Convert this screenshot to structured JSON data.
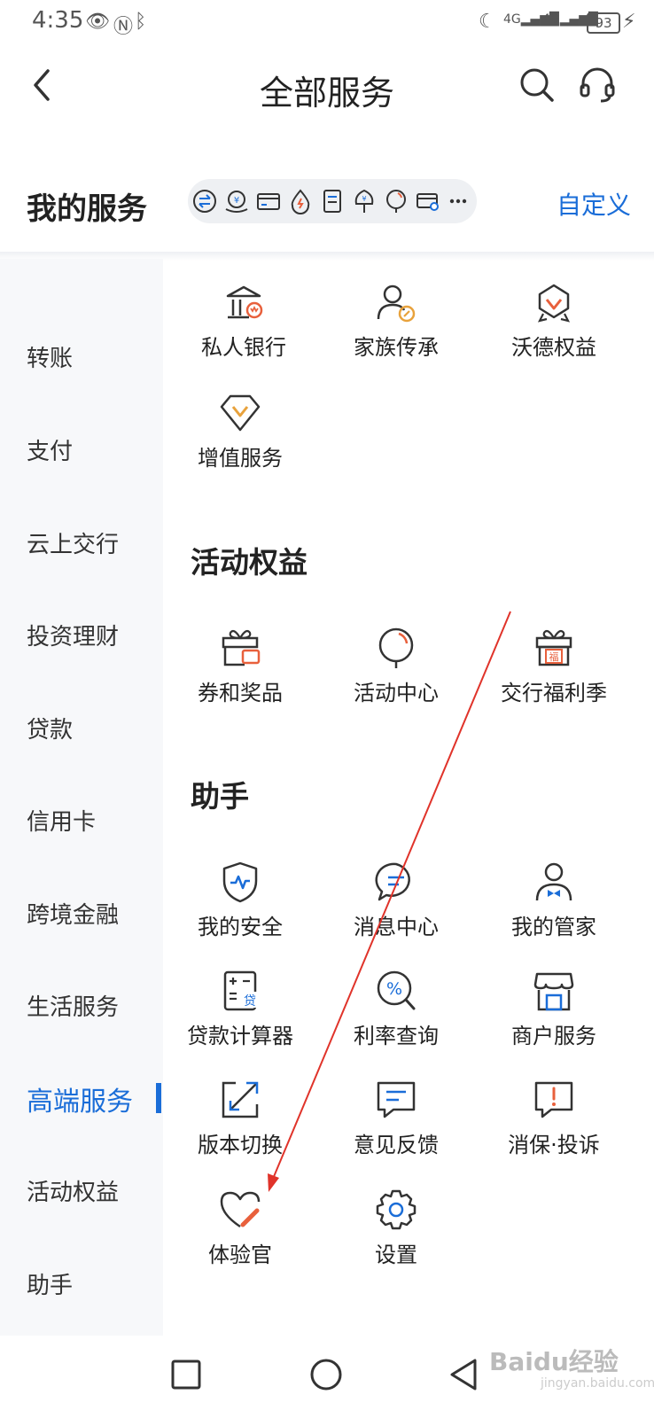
{
  "status_bar": {
    "time": "4:35",
    "battery": "93",
    "icons": [
      "eye-icon",
      "nfc-icon",
      "bluetooth-icon",
      "moon-icon",
      "signal-4g-icon",
      "signal-4g-icon",
      "charging-icon"
    ]
  },
  "header": {
    "title": "全部服务",
    "icons": [
      "back-arrow-icon",
      "search-icon",
      "headset-icon"
    ]
  },
  "my_services": {
    "title": "我的服务",
    "customize_label": "自定义",
    "shortcut_icons": [
      "transfer-icon",
      "wealth-icon",
      "card-icon",
      "water-icon",
      "bill-icon",
      "fund-tree-icon",
      "balloon-icon",
      "card-link-icon",
      "more-icon"
    ]
  },
  "sidebar": {
    "items": [
      {
        "label": "转账"
      },
      {
        "label": "支付"
      },
      {
        "label": "云上交行"
      },
      {
        "label": "投资理财"
      },
      {
        "label": "贷款"
      },
      {
        "label": "信用卡"
      },
      {
        "label": "跨境金融"
      },
      {
        "label": "生活服务"
      },
      {
        "label": "高端服务",
        "active": true
      },
      {
        "label": "活动权益"
      },
      {
        "label": "助手"
      }
    ]
  },
  "content": {
    "high_end": {
      "items": [
        {
          "label": "私人银行",
          "icon": "bank-icon"
        },
        {
          "label": "家族传承",
          "icon": "family-icon"
        },
        {
          "label": "沃德权益",
          "icon": "badge-icon"
        },
        {
          "label": "增值服务",
          "icon": "diamond-icon"
        }
      ]
    },
    "activities": {
      "title": "活动权益",
      "items": [
        {
          "label": "券和奖品",
          "icon": "gift-coupon-icon"
        },
        {
          "label": "活动中心",
          "icon": "balloon-icon"
        },
        {
          "label": "交行福利季",
          "icon": "gift-box-icon"
        }
      ]
    },
    "assistant": {
      "title": "助手",
      "items": [
        {
          "label": "我的安全",
          "icon": "shield-icon"
        },
        {
          "label": "消息中心",
          "icon": "message-icon"
        },
        {
          "label": "我的管家",
          "icon": "butler-icon"
        },
        {
          "label": "贷款计算器",
          "icon": "calculator-icon"
        },
        {
          "label": "利率查询",
          "icon": "percent-icon"
        },
        {
          "label": "商户服务",
          "icon": "store-icon"
        },
        {
          "label": "版本切换",
          "icon": "switch-icon"
        },
        {
          "label": "意见反馈",
          "icon": "feedback-icon"
        },
        {
          "label": "消保·投诉",
          "icon": "complaint-icon"
        },
        {
          "label": "体验官",
          "icon": "heart-pen-icon"
        },
        {
          "label": "设置",
          "icon": "gear-icon"
        }
      ]
    }
  },
  "nav_bar": {
    "icons": [
      "recent-apps-icon",
      "home-icon",
      "back-icon"
    ]
  },
  "watermark": {
    "text": "Baidu经验",
    "sub": "jingyan.baidu.com"
  },
  "colors": {
    "accent": "#1a6dd8",
    "icon_stroke": "#333333",
    "icon_highlight": "#e8603c",
    "annotation_arrow": "#e0332a"
  }
}
